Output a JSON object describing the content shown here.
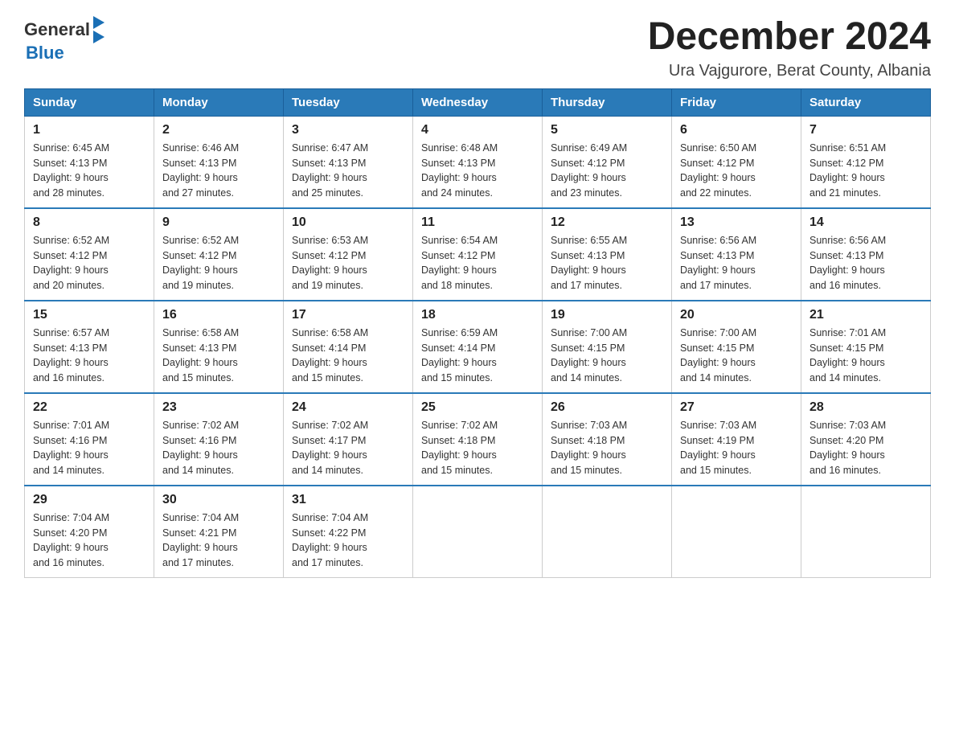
{
  "header": {
    "logo": {
      "general": "General",
      "blue": "Blue"
    },
    "title": "December 2024",
    "subtitle": "Ura Vajgurore, Berat County, Albania"
  },
  "days_of_week": [
    "Sunday",
    "Monday",
    "Tuesday",
    "Wednesday",
    "Thursday",
    "Friday",
    "Saturday"
  ],
  "weeks": [
    [
      {
        "day": "1",
        "sunrise": "6:45 AM",
        "sunset": "4:13 PM",
        "daylight": "9 hours and 28 minutes."
      },
      {
        "day": "2",
        "sunrise": "6:46 AM",
        "sunset": "4:13 PM",
        "daylight": "9 hours and 27 minutes."
      },
      {
        "day": "3",
        "sunrise": "6:47 AM",
        "sunset": "4:13 PM",
        "daylight": "9 hours and 25 minutes."
      },
      {
        "day": "4",
        "sunrise": "6:48 AM",
        "sunset": "4:13 PM",
        "daylight": "9 hours and 24 minutes."
      },
      {
        "day": "5",
        "sunrise": "6:49 AM",
        "sunset": "4:12 PM",
        "daylight": "9 hours and 23 minutes."
      },
      {
        "day": "6",
        "sunrise": "6:50 AM",
        "sunset": "4:12 PM",
        "daylight": "9 hours and 22 minutes."
      },
      {
        "day": "7",
        "sunrise": "6:51 AM",
        "sunset": "4:12 PM",
        "daylight": "9 hours and 21 minutes."
      }
    ],
    [
      {
        "day": "8",
        "sunrise": "6:52 AM",
        "sunset": "4:12 PM",
        "daylight": "9 hours and 20 minutes."
      },
      {
        "day": "9",
        "sunrise": "6:52 AM",
        "sunset": "4:12 PM",
        "daylight": "9 hours and 19 minutes."
      },
      {
        "day": "10",
        "sunrise": "6:53 AM",
        "sunset": "4:12 PM",
        "daylight": "9 hours and 19 minutes."
      },
      {
        "day": "11",
        "sunrise": "6:54 AM",
        "sunset": "4:12 PM",
        "daylight": "9 hours and 18 minutes."
      },
      {
        "day": "12",
        "sunrise": "6:55 AM",
        "sunset": "4:13 PM",
        "daylight": "9 hours and 17 minutes."
      },
      {
        "day": "13",
        "sunrise": "6:56 AM",
        "sunset": "4:13 PM",
        "daylight": "9 hours and 17 minutes."
      },
      {
        "day": "14",
        "sunrise": "6:56 AM",
        "sunset": "4:13 PM",
        "daylight": "9 hours and 16 minutes."
      }
    ],
    [
      {
        "day": "15",
        "sunrise": "6:57 AM",
        "sunset": "4:13 PM",
        "daylight": "9 hours and 16 minutes."
      },
      {
        "day": "16",
        "sunrise": "6:58 AM",
        "sunset": "4:13 PM",
        "daylight": "9 hours and 15 minutes."
      },
      {
        "day": "17",
        "sunrise": "6:58 AM",
        "sunset": "4:14 PM",
        "daylight": "9 hours and 15 minutes."
      },
      {
        "day": "18",
        "sunrise": "6:59 AM",
        "sunset": "4:14 PM",
        "daylight": "9 hours and 15 minutes."
      },
      {
        "day": "19",
        "sunrise": "7:00 AM",
        "sunset": "4:15 PM",
        "daylight": "9 hours and 14 minutes."
      },
      {
        "day": "20",
        "sunrise": "7:00 AM",
        "sunset": "4:15 PM",
        "daylight": "9 hours and 14 minutes."
      },
      {
        "day": "21",
        "sunrise": "7:01 AM",
        "sunset": "4:15 PM",
        "daylight": "9 hours and 14 minutes."
      }
    ],
    [
      {
        "day": "22",
        "sunrise": "7:01 AM",
        "sunset": "4:16 PM",
        "daylight": "9 hours and 14 minutes."
      },
      {
        "day": "23",
        "sunrise": "7:02 AM",
        "sunset": "4:16 PM",
        "daylight": "9 hours and 14 minutes."
      },
      {
        "day": "24",
        "sunrise": "7:02 AM",
        "sunset": "4:17 PM",
        "daylight": "9 hours and 14 minutes."
      },
      {
        "day": "25",
        "sunrise": "7:02 AM",
        "sunset": "4:18 PM",
        "daylight": "9 hours and 15 minutes."
      },
      {
        "day": "26",
        "sunrise": "7:03 AM",
        "sunset": "4:18 PM",
        "daylight": "9 hours and 15 minutes."
      },
      {
        "day": "27",
        "sunrise": "7:03 AM",
        "sunset": "4:19 PM",
        "daylight": "9 hours and 15 minutes."
      },
      {
        "day": "28",
        "sunrise": "7:03 AM",
        "sunset": "4:20 PM",
        "daylight": "9 hours and 16 minutes."
      }
    ],
    [
      {
        "day": "29",
        "sunrise": "7:04 AM",
        "sunset": "4:20 PM",
        "daylight": "9 hours and 16 minutes."
      },
      {
        "day": "30",
        "sunrise": "7:04 AM",
        "sunset": "4:21 PM",
        "daylight": "9 hours and 17 minutes."
      },
      {
        "day": "31",
        "sunrise": "7:04 AM",
        "sunset": "4:22 PM",
        "daylight": "9 hours and 17 minutes."
      },
      null,
      null,
      null,
      null
    ]
  ],
  "labels": {
    "sunrise": "Sunrise:",
    "sunset": "Sunset:",
    "daylight": "Daylight:"
  }
}
